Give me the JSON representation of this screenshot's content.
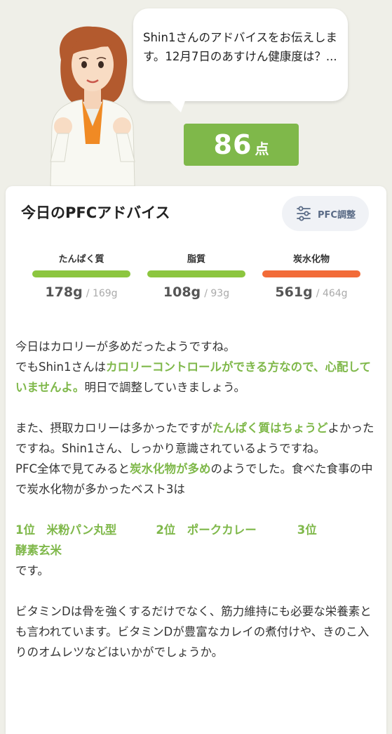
{
  "advisor": {
    "message": "Shin1さんのアドバイスをお伝えします。12月7日のあすけん健康度は？...",
    "score_value": "86",
    "score_unit": "点"
  },
  "card": {
    "title": "今日のPFCアドバイス",
    "pfc_button_label": "PFC調整",
    "nutrients": [
      {
        "label": "たんぱく質",
        "value": "178g",
        "goal": "/ 169g",
        "color": "#8cc63f"
      },
      {
        "label": "脂質",
        "value": "108g",
        "goal": "/ 93g",
        "color": "#8cc63f"
      },
      {
        "label": "炭水化物",
        "value": "561g",
        "goal": "/ 464g",
        "color": "#f26b38"
      }
    ]
  },
  "advice": {
    "p1": "今日はカロリーが多めだったようですね。",
    "p2_pre": "でもShin1さんは",
    "p2_hl": "カロリーコントロールができる方なので、心配していませんよ。",
    "p2_post": "明日で調整していきましょう。",
    "p3_pre": "また、摂取カロリーは多かったですが",
    "p3_hl": "たんぱく質はちょうど",
    "p3_post": "よかったですね。Shin1さん、しっかり意識されているようですね。",
    "p4_pre": "PFC全体で見てみると",
    "p4_hl": "炭水化物が多め",
    "p4_post": "のようでした。食べた食事の中で炭水化物が多かったベスト3は",
    "rank1": "1位　米粉パン丸型",
    "rank2": "2位　ポークカレー",
    "rank3_a": "3位",
    "rank3_b": "酵素玄米",
    "desu": "です。",
    "p6": "ビタミンDは骨を強くするだけでなく、筋力維持にも必要な栄養素とも言われています。ビタミンDが豊富なカレイの煮付けや、きのこ入りのオムレツなどはいかがでしょうか。"
  }
}
